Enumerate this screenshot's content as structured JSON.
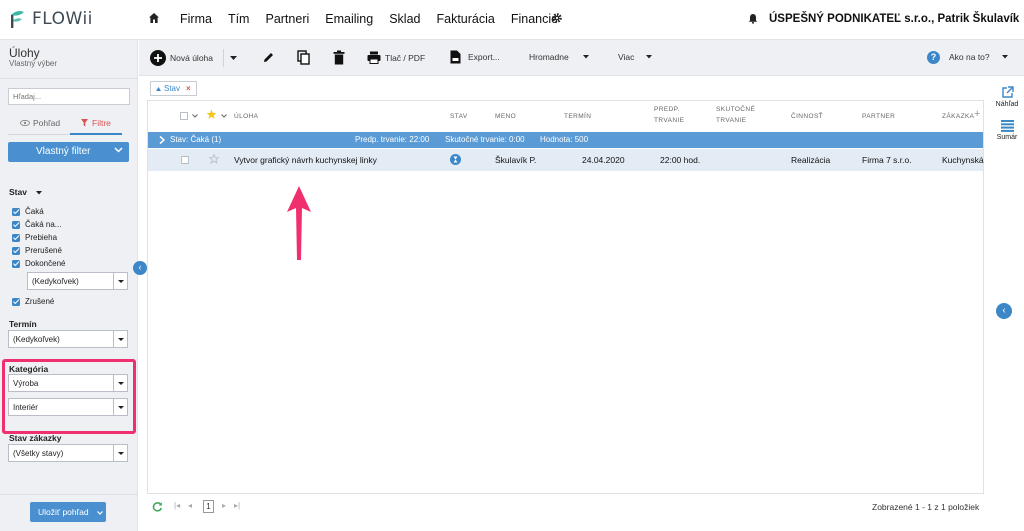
{
  "brand": {
    "name": "FLOWii"
  },
  "nav": {
    "items": [
      "Firma",
      "Tím",
      "Partneri",
      "Emailing",
      "Sklad",
      "Fakturácia",
      "Financie"
    ]
  },
  "user": {
    "company": "ÚSPEŠNÝ PODNIKATEĽ s.r.o., Patrik Škulavík"
  },
  "page": {
    "title": "Úlohy",
    "subtitle": "Vlastný výber"
  },
  "search": {
    "placeholder": "Hľadaj..."
  },
  "view_toggle": {
    "view_label": "Pohľad",
    "filter_label": "Filtre"
  },
  "custom_filter": {
    "label": "Vlastný filter"
  },
  "filters": {
    "status": {
      "label": "Stav",
      "options": [
        "Čaká",
        "Čaká na...",
        "Prebieha",
        "Prerušené",
        "Dokončené"
      ],
      "select_value": "(Kedykoľvek)",
      "cancelled": "Zrušené"
    },
    "deadline": {
      "label": "Termín",
      "value": "(Kedykoľvek)"
    },
    "category": {
      "label": "Kategória",
      "value1": "Výroba",
      "value2": "Interiér"
    },
    "order_status": {
      "label": "Stav zákazky",
      "value": "(Všetky stavy)"
    }
  },
  "save_view": {
    "label": "Uložiť pohľad"
  },
  "toolbar": {
    "new_task": "Nová úloha",
    "print": "Tlač / PDF",
    "export": "Export...",
    "bulk": "Hromadne",
    "more": "Viac",
    "help": "Ako na to?"
  },
  "chip": {
    "label": "Stav"
  },
  "columns": {
    "task": "ÚLOHA",
    "status": "STAV",
    "name": "MENO",
    "deadline": "TERMÍN",
    "planned": [
      "PREDP.",
      "TRVANIE"
    ],
    "actual": [
      "SKUTOČNÉ",
      "TRVANIE"
    ],
    "activity": "ČINNOSŤ",
    "partner": "PARTNER",
    "order": "ZÁKAZKA"
  },
  "group": {
    "label": "Stav: Čaká (1)",
    "planned": "Predp. trvanie: 22:00",
    "actual": "Skutočné trvanie: 0:00",
    "value": "Hodnota: 500"
  },
  "rows": [
    {
      "task": "Vytvor grafický návrh kuchynskej linky",
      "name": "Škulavík P.",
      "deadline": "24.04.2020",
      "planned": "22:00 hod.",
      "activity": "Realizácia",
      "partner": "Firma 7 s.r.o.",
      "order": "Kuchynská"
    }
  ],
  "pagination": {
    "page": "1",
    "summary": "Zobrazené 1 - 1 z 1 položiek"
  },
  "right_tools": {
    "preview": "Náhľad",
    "summary": "Sumár"
  },
  "colors": {
    "accent": "#3b87c8",
    "highlight": "#f0306e",
    "group_bar": "#5b9bd5",
    "row_bg": "#e3ebf4"
  }
}
